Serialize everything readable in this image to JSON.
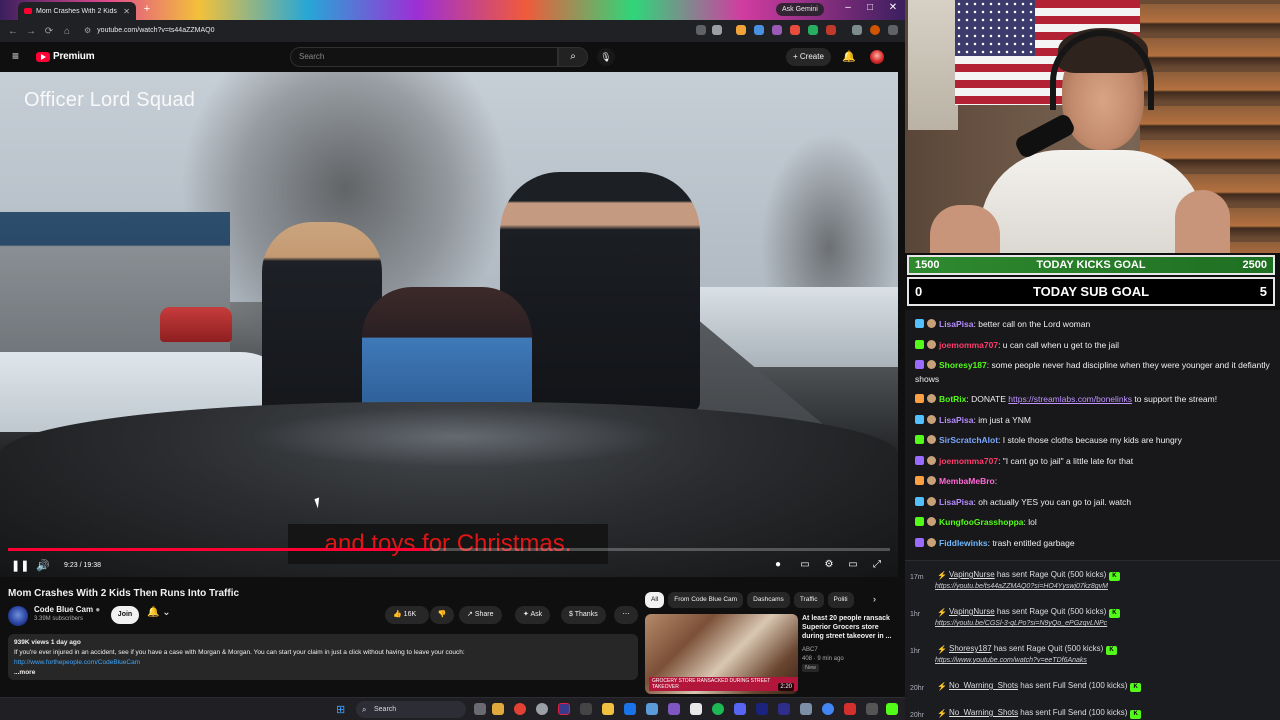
{
  "browser": {
    "tab_title": "Mom Crashes With 2 Kids T",
    "gemini_label": "Ask Gemini",
    "url": "youtube.com/watch?v=ts44aZZMAQ0"
  },
  "youtube": {
    "logo_word": "Premium",
    "search_placeholder": "Search",
    "create_label": "Create"
  },
  "video": {
    "watermark": "Officer Lord Squad",
    "caption": "and toys for Christmas.",
    "time": "9:23 / 19:38",
    "progress_fraction": 0.478
  },
  "info": {
    "title": "Mom Crashes With 2 Kids Then Runs Into Traffic",
    "channel": "Code Blue Cam",
    "subscribers": "3.39M subscribers",
    "join_label": "Join",
    "likes": "16K",
    "share_label": "Share",
    "ask_label": "Ask",
    "thanks_label": "Thanks",
    "desc_meta": "939K views  1 day ago",
    "desc_line": "If you're ever injured in an accident, see if you have a case with Morgan & Morgan. You can start your claim in just a click without having to leave your couch:",
    "desc_link": "http://www.forthepeople.com/CodeBlueCam",
    "desc_more": "...more"
  },
  "chips": [
    "All",
    "From Code Blue Cam",
    "Dashcams",
    "Traffic",
    "Politi"
  ],
  "recommended": {
    "title": "At least 20 people ransack Superior Grocers store during street takeover in ...",
    "channel": "ABC7",
    "meta": "408 · 9 min ago",
    "badge": "New",
    "thumb_caption": "GROCERY STORE RANSACKED DURING STREET TAKEOVER",
    "duration": "2:20"
  },
  "taskbar": {
    "search_label": "Search"
  },
  "goals": {
    "kicks": {
      "left": "1500",
      "label": "TODAY KICKS GOAL",
      "right": "2500"
    },
    "subs": {
      "left": "0",
      "label": "TODAY SUB GOAL",
      "right": "5"
    }
  },
  "chat": [
    {
      "user": "LisaPisa",
      "color": "#b58cff",
      "text": ": better call on the Lord woman"
    },
    {
      "user": "joemomma707",
      "color": "#ff3b6b",
      "text": ": u can call when u get to the jail"
    },
    {
      "user": "Shoresy187",
      "color": "#53fc18",
      "text": ": some people never had discipline when they were younger and it defiantly shows"
    },
    {
      "user": "BotRix",
      "color": "#53fc18",
      "text": ": DONATE ",
      "link": "https://streamlabs.com/bonelinks",
      "tail": " to support the stream!"
    },
    {
      "user": "LisaPisa",
      "color": "#b58cff",
      "text": ": im just a YNM"
    },
    {
      "user": "SirScratchAlot",
      "color": "#7aa8ff",
      "text": ": I stole those cloths because my kids are hungry"
    },
    {
      "user": "joemomma707",
      "color": "#ff3b6b",
      "text": ": \"I cant go to jail\" a little late for that"
    },
    {
      "user": "MembaMeBro",
      "color": "#ff6bd5",
      "text": ":"
    },
    {
      "user": "LisaPisa",
      "color": "#b58cff",
      "text": ": oh actually YES you can go to jail. watch"
    },
    {
      "user": "KungfooGrasshoppa",
      "color": "#53fc18",
      "text": ": lol"
    },
    {
      "user": "Fiddlewinks",
      "color": "#6fb8ff",
      "text": ": trash entitled garbage"
    }
  ],
  "activity": [
    {
      "age": "17m",
      "user": "VapingNurse",
      "text": " has sent Rage Quit (500 kicks)",
      "link": "https://youtu.be/ts44aZZMAQ0?si=HO4Yyswj07kz8gvM"
    },
    {
      "age": "1hr",
      "user": "VapingNurse",
      "text": " has sent Rage Quit (500 kicks)",
      "link": "https://youtu.be/CGSl-3-qLPo?si=N9yQo_ePGzqvLNPc"
    },
    {
      "age": "1hr",
      "user": "Shoresy187",
      "text": " has sent Rage Quit (500 kicks)",
      "link": "https://www.youtube.com/watch?v=eeTDf6Anaks"
    },
    {
      "age": "20hr",
      "user": "No_Warning_Shots",
      "text": " has sent Full Send (100 kicks)",
      "link": ""
    },
    {
      "age": "20hr",
      "user": "No_Warning_Shots",
      "text": " has sent Full Send (100 kicks)",
      "link": ""
    }
  ],
  "colors": {
    "youtube_red": "#ff0033",
    "kick_green": "#53fc18",
    "chat_bg": "#18181b"
  }
}
